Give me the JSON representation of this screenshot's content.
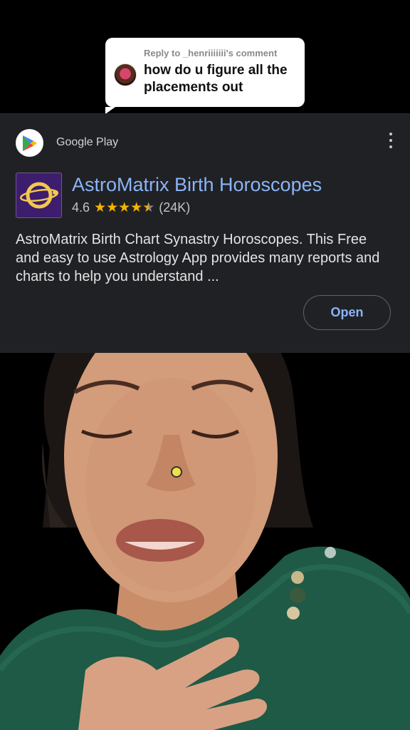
{
  "reply": {
    "header": "Reply to _henriiiiiii's comment",
    "text": "how do u figure all the placements out"
  },
  "ad": {
    "source": "Google Play",
    "app_name": "AstroMatrix Birth Horoscopes",
    "rating": "4.6",
    "rating_value_stars": 4.6,
    "reviews": "(24K)",
    "description": "AstroMatrix Birth Chart Synastry Horoscopes. This Free and easy to use Astrology App provides many reports and charts to help you understand ...",
    "open_label": "Open",
    "icons": {
      "source": "google-play-icon",
      "menu": "more-vert-icon",
      "app": "astromatrix-app-icon"
    }
  },
  "colors": {
    "card_bg": "#202124",
    "link_blue": "#8ab4f8",
    "star_yellow": "#f6b400",
    "sweater_green": "#1e5a45"
  }
}
